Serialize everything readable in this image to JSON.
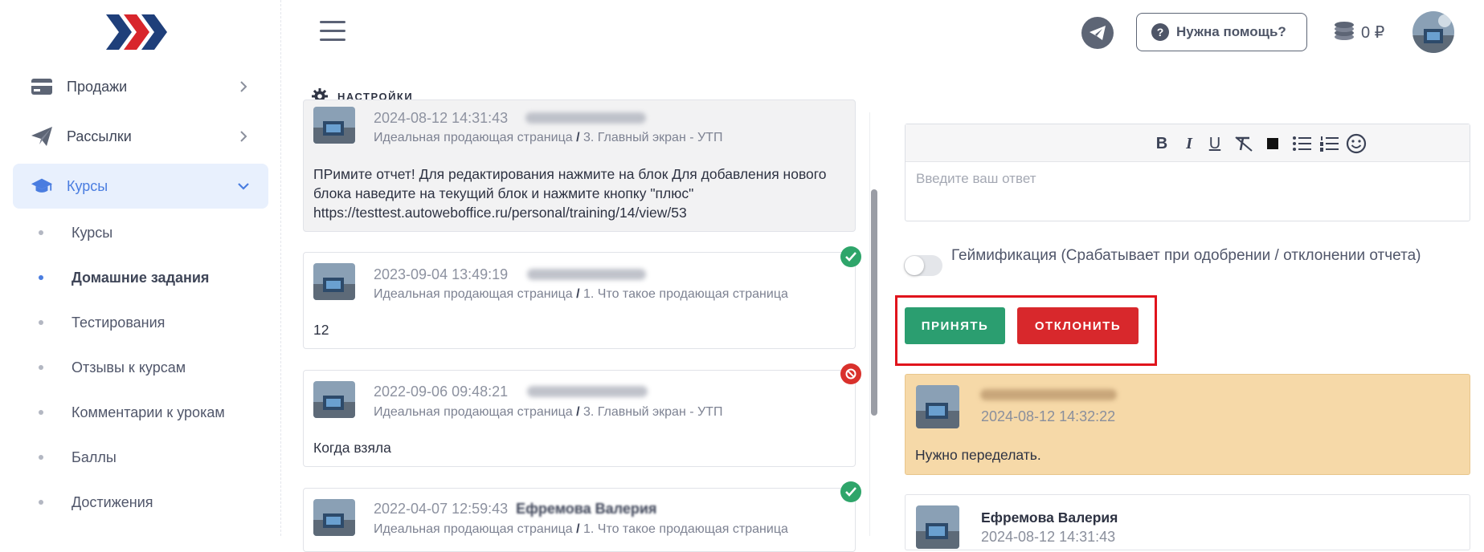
{
  "sidebar": {
    "items": [
      {
        "label": "Продажи"
      },
      {
        "label": "Рассылки"
      },
      {
        "label": "Курсы"
      }
    ],
    "subitems": [
      {
        "label": "Курсы"
      },
      {
        "label": "Домашние задания"
      },
      {
        "label": "Тестирования"
      },
      {
        "label": "Отзывы к курсам"
      },
      {
        "label": "Комментарии к урокам"
      },
      {
        "label": "Баллы"
      },
      {
        "label": "Достижения"
      }
    ]
  },
  "header": {
    "help_label": "Нужна помощь?",
    "help_icon": "?",
    "balance": "0 ₽"
  },
  "settings_label": "НАСТРОЙКИ",
  "reports": [
    {
      "date": "2024-08-12 14:31:43",
      "path_course": "Идеальная продающая страница",
      "path_sep": "/",
      "path_lesson": "3. Главный экран - УТП",
      "body": "ПРимите отчет! Для редактирования нажмите на блок Для добавления нового блока наведите на текущий блок и нажмите кнопку \"плюс\" https://testtest.autoweboffice.ru/personal/training/14/view/53"
    },
    {
      "date": "2023-09-04 13:49:19",
      "path_course": "Идеальная продающая страница",
      "path_sep": "/",
      "path_lesson": "1. Что такое продающая страница",
      "body": "12",
      "status": "accepted"
    },
    {
      "date": "2022-09-06 09:48:21",
      "path_course": "Идеальная продающая страница",
      "path_sep": "/",
      "path_lesson": "3. Главный экран - УТП",
      "body": "Когда взяла",
      "status": "rejected"
    },
    {
      "date": "2022-04-07 12:59:43",
      "name": "Ефремова Валерия",
      "path_course": "Идеальная продающая страница",
      "path_sep": "/",
      "path_lesson": "1. Что такое продающая страница",
      "status": "accepted"
    }
  ],
  "editor": {
    "placeholder": "Введите ваш ответ",
    "tools": [
      "B",
      "I",
      "U"
    ]
  },
  "gamification_label": "Геймификация (Срабатывает при одобрении / отклонении отчета)",
  "actions": {
    "accept": "ПРИНЯТЬ",
    "reject": "ОТКЛОНИТЬ"
  },
  "replies": [
    {
      "date": "2024-08-12 14:32:22",
      "text": "Нужно переделать."
    },
    {
      "name": "Ефремова Валерия",
      "date": "2024-08-12 14:31:43"
    }
  ],
  "colors": {
    "accent": "#4a7de0",
    "accept": "#2b9e70",
    "reject": "#d8282c",
    "reply_bg": "#f6d9a8",
    "highlight": "#e0141c"
  }
}
